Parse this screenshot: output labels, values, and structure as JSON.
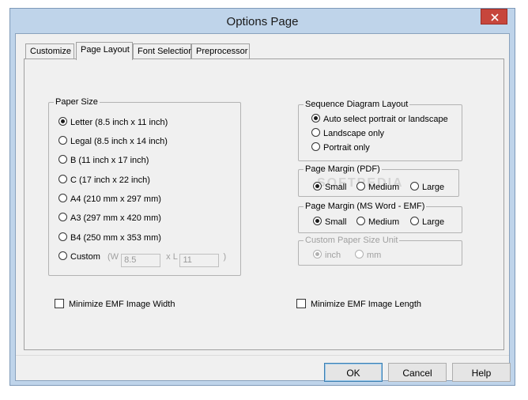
{
  "window": {
    "title": "Options Page"
  },
  "tabs": [
    {
      "label": "Customize"
    },
    {
      "label": "Page Layout"
    },
    {
      "label": "Font Selection"
    },
    {
      "label": "Preprocessor"
    }
  ],
  "paper_size": {
    "legend": "Paper Size",
    "options": [
      "Letter (8.5 inch x 11 inch)",
      "Legal (8.5 inch x 14 inch)",
      "B (11 inch x 17 inch)",
      "C (17 inch x 22 inch)",
      "A4 (210 mm x 297 mm)",
      "A3 (297 mm x 420 mm)",
      "B4 (250 mm x 353 mm)"
    ],
    "selected": "Letter (8.5 inch x 11 inch)",
    "custom": {
      "label": "Custom",
      "w_prefix": "(W",
      "width": "8.5",
      "x_label": "x L",
      "length": "11",
      "suffix": ")"
    }
  },
  "sequence_layout": {
    "legend": "Sequence Diagram Layout",
    "options": [
      "Auto select portrait or landscape",
      "Landscape only",
      "Portrait only"
    ],
    "selected": "Auto select portrait or landscape"
  },
  "margin_pdf": {
    "legend": "Page Margin (PDF)",
    "options": [
      "Small",
      "Medium",
      "Large"
    ],
    "selected": "Small"
  },
  "margin_word": {
    "legend": "Page Margin (MS Word - EMF)",
    "options": [
      "Small",
      "Medium",
      "Large"
    ],
    "selected": "Small"
  },
  "custom_unit": {
    "legend": "Custom Paper Size Unit",
    "options": [
      "inch",
      "mm"
    ],
    "selected": "inch"
  },
  "checkboxes": {
    "min_width": "Minimize EMF Image Width",
    "min_length": "Minimize EMF Image Length"
  },
  "buttons": {
    "ok": "OK",
    "cancel": "Cancel",
    "help": "Help"
  },
  "watermark": "SOFTPEDIA"
}
